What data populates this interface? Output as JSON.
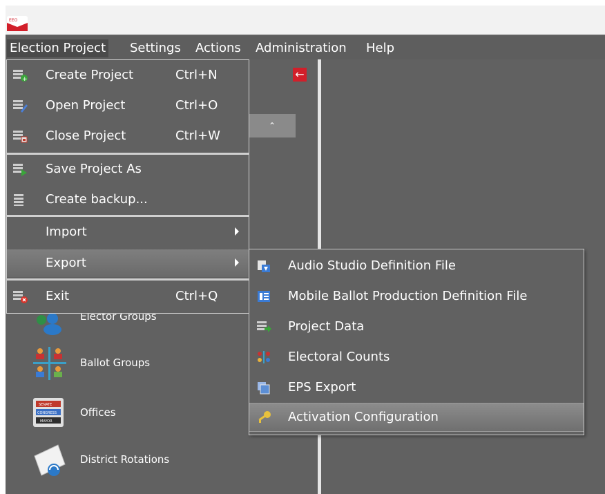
{
  "menubar": {
    "items": [
      {
        "label": "Election Project"
      },
      {
        "label": "Settings"
      },
      {
        "label": "Actions"
      },
      {
        "label": "Administration"
      },
      {
        "label": "Help"
      }
    ]
  },
  "dropdown": {
    "items": [
      {
        "icon": "create-project-icon",
        "label": "Create Project",
        "shortcut": "Ctrl+N"
      },
      {
        "icon": "open-project-icon",
        "label": "Open Project",
        "shortcut": "Ctrl+O"
      },
      {
        "icon": "close-project-icon",
        "label": "Close Project",
        "shortcut": "Ctrl+W"
      },
      {
        "icon": "save-project-as-icon",
        "label": "Save Project As",
        "shortcut": ""
      },
      {
        "icon": "create-backup-icon",
        "label": "Create backup...",
        "shortcut": ""
      },
      {
        "icon": "",
        "label": "Import",
        "shortcut": ""
      },
      {
        "icon": "",
        "label": "Export",
        "shortcut": ""
      },
      {
        "icon": "exit-icon",
        "label": "Exit",
        "shortcut": "Ctrl+Q"
      }
    ]
  },
  "submenu": {
    "items": [
      {
        "icon": "audio-studio-icon",
        "label": "Audio Studio Definition File"
      },
      {
        "icon": "mobile-ballot-icon",
        "label": "Mobile Ballot Production Definition File"
      },
      {
        "icon": "project-data-icon",
        "label": "Project Data"
      },
      {
        "icon": "electoral-counts-icon",
        "label": "Electoral Counts"
      },
      {
        "icon": "eps-export-icon",
        "label": "EPS Export"
      },
      {
        "icon": "key-icon",
        "label": "Activation Configuration"
      }
    ]
  },
  "nav": {
    "items": [
      {
        "icon": "elector-groups-icon",
        "label": "Elector Groups"
      },
      {
        "icon": "ballot-groups-icon",
        "label": "Ballot Groups"
      },
      {
        "icon": "offices-icon",
        "label": "Offices"
      },
      {
        "icon": "district-rotations-icon",
        "label": "District Rotations"
      }
    ]
  },
  "logo_text": "EEO",
  "offices_icon_text": [
    "SENATE",
    "CONGRESS",
    "MAYOR"
  ],
  "colors": {
    "accent": "#d21f2a",
    "menubar": "#5e5e5e",
    "panel": "#616161"
  }
}
